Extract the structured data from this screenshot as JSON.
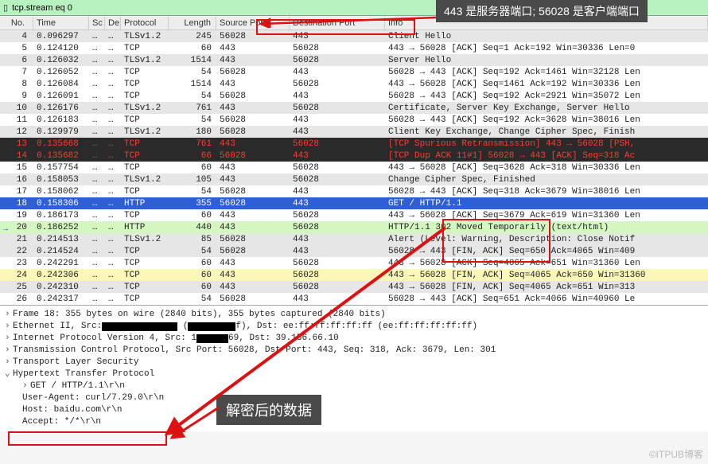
{
  "filter": {
    "value": "tcp.stream eq 0"
  },
  "callouts": {
    "top": "443 是服务器端口; 56028 是客户端端口",
    "bottom": "解密后的数据"
  },
  "watermark": "©ITPUB博客",
  "columns": {
    "no": "No.",
    "time": "Time",
    "sc": "Sc",
    "de": "De",
    "proto": "Protocol",
    "len": "Length",
    "sport": "Source Port",
    "dport": "Destination Port",
    "info": "Info"
  },
  "packets": [
    {
      "no": 4,
      "time": "0.096297",
      "sc": "…",
      "de": "…",
      "proto": "TLSv1.2",
      "len": 245,
      "sport": "56028",
      "dport": "443",
      "info": "Client Hello",
      "bg": "bg-grey"
    },
    {
      "no": 5,
      "time": "0.124120",
      "sc": "…",
      "de": "…",
      "proto": "TCP",
      "len": 60,
      "sport": "443",
      "dport": "56028",
      "info": "443 → 56028 [ACK] Seq=1 Ack=192 Win=30336 Len=0",
      "bg": "bg-default"
    },
    {
      "no": 6,
      "time": "0.126032",
      "sc": "…",
      "de": "…",
      "proto": "TLSv1.2",
      "len": 1514,
      "sport": "443",
      "dport": "56028",
      "info": "Server Hello",
      "bg": "bg-grey"
    },
    {
      "no": 7,
      "time": "0.126052",
      "sc": "…",
      "de": "…",
      "proto": "TCP",
      "len": 54,
      "sport": "56028",
      "dport": "443",
      "info": "56028 → 443 [ACK] Seq=192 Ack=1461 Win=32128 Len",
      "bg": "bg-default"
    },
    {
      "no": 8,
      "time": "0.126084",
      "sc": "…",
      "de": "…",
      "proto": "TCP",
      "len": 1514,
      "sport": "443",
      "dport": "56028",
      "info": "443 → 56028 [ACK] Seq=1461 Ack=192 Win=30336 Len",
      "bg": "bg-default"
    },
    {
      "no": 9,
      "time": "0.126091",
      "sc": "…",
      "de": "…",
      "proto": "TCP",
      "len": 54,
      "sport": "56028",
      "dport": "443",
      "info": "56028 → 443 [ACK] Seq=192 Ack=2921 Win=35072 Len",
      "bg": "bg-default"
    },
    {
      "no": 10,
      "time": "0.126176",
      "sc": "…",
      "de": "…",
      "proto": "TLSv1.2",
      "len": 761,
      "sport": "443",
      "dport": "56028",
      "info": "Certificate, Server Key Exchange, Server Hello",
      "bg": "bg-grey"
    },
    {
      "no": 11,
      "time": "0.126183",
      "sc": "…",
      "de": "…",
      "proto": "TCP",
      "len": 54,
      "sport": "56028",
      "dport": "443",
      "info": "56028 → 443 [ACK] Seq=192 Ack=3628 Win=38016 Len",
      "bg": "bg-default"
    },
    {
      "no": 12,
      "time": "0.129979",
      "sc": "…",
      "de": "…",
      "proto": "TLSv1.2",
      "len": 180,
      "sport": "56028",
      "dport": "443",
      "info": "Client Key Exchange, Change Cipher Spec, Finish",
      "bg": "bg-grey"
    },
    {
      "no": 13,
      "time": "0.135668",
      "sc": "…",
      "de": "…",
      "proto": "TCP",
      "len": 761,
      "sport": "443",
      "dport": "56028",
      "info": "[TCP Spurious Retransmission] 443 → 56028 [PSH,",
      "bg": "bg-red"
    },
    {
      "no": 14,
      "time": "0.135682",
      "sc": "…",
      "de": "…",
      "proto": "TCP",
      "len": 66,
      "sport": "56028",
      "dport": "443",
      "info": "[TCP Dup ACK 11#1] 56028 → 443 [ACK] Seq=318 Ac",
      "bg": "bg-red"
    },
    {
      "no": 15,
      "time": "0.157754",
      "sc": "…",
      "de": "…",
      "proto": "TCP",
      "len": 60,
      "sport": "443",
      "dport": "56028",
      "info": "443 → 56028 [ACK] Seq=3628 Ack=318 Win=30336 Len",
      "bg": "bg-default"
    },
    {
      "no": 16,
      "time": "0.158053",
      "sc": "…",
      "de": "…",
      "proto": "TLSv1.2",
      "len": 105,
      "sport": "443",
      "dport": "56028",
      "info": "Change Cipher Spec, Finished",
      "bg": "bg-grey"
    },
    {
      "no": 17,
      "time": "0.158062",
      "sc": "…",
      "de": "…",
      "proto": "TCP",
      "len": 54,
      "sport": "56028",
      "dport": "443",
      "info": "56028 → 443 [ACK] Seq=318 Ack=3679 Win=38016 Len",
      "bg": "bg-default"
    },
    {
      "no": 18,
      "time": "0.158306",
      "sc": "…",
      "de": "…",
      "proto": "HTTP",
      "len": 355,
      "sport": "56028",
      "dport": "443",
      "info": "GET / HTTP/1.1",
      "bg": "bg-blue"
    },
    {
      "no": 19,
      "time": "0.186173",
      "sc": "…",
      "de": "…",
      "proto": "TCP",
      "len": 60,
      "sport": "443",
      "dport": "56028",
      "info": "443 → 56028 [ACK] Seq=3679 Ack=619 Win=31360 Len",
      "bg": "bg-default"
    },
    {
      "no": 20,
      "time": "0.186252",
      "sc": "…",
      "de": "…",
      "proto": "HTTP",
      "len": 440,
      "sport": "443",
      "dport": "56028",
      "info": "HTTP/1.1 302 Moved Temporarily  (text/html)",
      "bg": "bg-green"
    },
    {
      "no": 21,
      "time": "0.214513",
      "sc": "…",
      "de": "…",
      "proto": "TLSv1.2",
      "len": 85,
      "sport": "56028",
      "dport": "443",
      "info": "Alert (Level: Warning, Description: Close Notif",
      "bg": "bg-grey"
    },
    {
      "no": 22,
      "time": "0.214524",
      "sc": "…",
      "de": "…",
      "proto": "TCP",
      "len": 54,
      "sport": "56028",
      "dport": "443",
      "info": "56028 → 443 [FIN, ACK] Seq=650 Ack=4065 Win=409",
      "bg": "bg-grey"
    },
    {
      "no": 23,
      "time": "0.242291",
      "sc": "…",
      "de": "…",
      "proto": "TCP",
      "len": 60,
      "sport": "443",
      "dport": "56028",
      "info": "443 → 56028 [ACK] Seq=4065 Ack=651 Win=31360 Len",
      "bg": "bg-default"
    },
    {
      "no": 24,
      "time": "0.242306",
      "sc": "…",
      "de": "…",
      "proto": "TCP",
      "len": 60,
      "sport": "443",
      "dport": "56028",
      "info": "443 → 56028 [FIN, ACK] Seq=4065 Ack=650 Win=31360",
      "bg": "bg-yellow"
    },
    {
      "no": 25,
      "time": "0.242310",
      "sc": "…",
      "de": "…",
      "proto": "TCP",
      "len": 60,
      "sport": "443",
      "dport": "56028",
      "info": "443 → 56028 [FIN, ACK] Seq=4065 Ack=651 Win=313",
      "bg": "bg-grey"
    },
    {
      "no": 26,
      "time": "0.242317",
      "sc": "…",
      "de": "…",
      "proto": "TCP",
      "len": 54,
      "sport": "56028",
      "dport": "443",
      "info": "56028 → 443 [ACK] Seq=651 Ack=4066 Win=40960 Le",
      "bg": "bg-default"
    }
  ],
  "details": {
    "frame": "Frame 18: 355 bytes on wire (2840 bits), 355 bytes captured (2840 bits)",
    "ether_prefix": "Ethernet II, Src: ",
    "ether_suffix": "f), Dst: ee:ff:ff:ff:ff:ff (ee:ff:ff:ff:ff:ff)",
    "ip_prefix": "Internet Protocol Version 4, Src: 1",
    "ip_suffix": "69, Dst: 39.156.66.10",
    "tcp": "Transmission Control Protocol, Src Port: 56028, Dst Port: 443, Seq: 318, Ack: 3679, Len: 301",
    "tls": "Transport Layer Security",
    "http": "Hypertext Transfer Protocol",
    "get": "GET / HTTP/1.1\\r\\n",
    "ua": "User-Agent: curl/7.29.0\\r\\n",
    "host": "Host: baidu.com\\r\\n",
    "accept": "Accept: */*\\r\\n"
  }
}
